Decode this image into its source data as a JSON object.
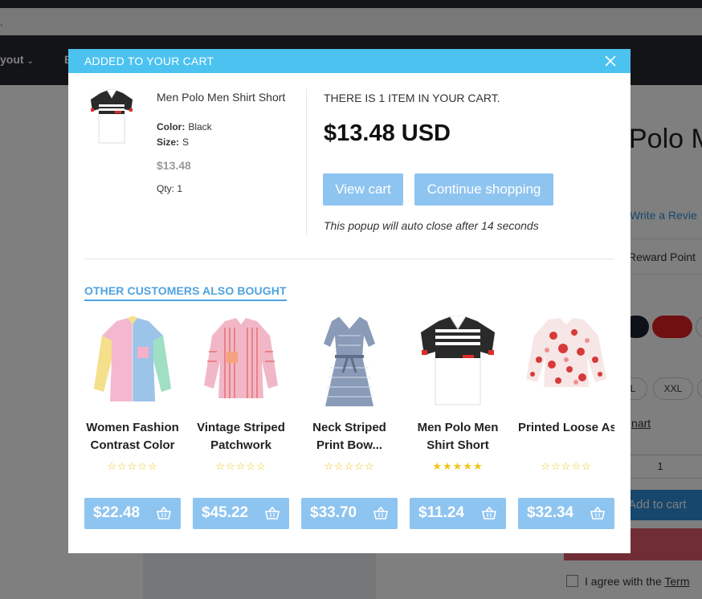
{
  "background": {
    "strip_text": ".",
    "nav_item_1": "yout",
    "nav_item_2": "E",
    "product_title": "Polo M",
    "review_link": "Write a Revie",
    "reward_points": "Reward Point",
    "size_l": "L",
    "size_xxl": "XXL",
    "compare_link": "nart",
    "qty_value": "1",
    "add_to_cart": "Add to cart",
    "agree_text": "I agree with the ",
    "terms_link": "Term"
  },
  "modal": {
    "title": "ADDED TO YOUR CART",
    "item": {
      "name": "Men Polo Men Shirt Short",
      "color_label": "Color:",
      "color_value": "Black",
      "size_label": "Size:",
      "size_value": "S",
      "price": "$13.48",
      "qty": "Qty: 1"
    },
    "cart_count": "THERE IS 1 ITEM IN YOUR CART.",
    "cart_total": "$13.48 USD",
    "view_cart_label": "View cart",
    "continue_label": "Continue shopping",
    "auto_close_text": "This popup will auto close after 14 seconds",
    "section_title": "OTHER CUSTOMERS ALSO BOUGHT",
    "products": [
      {
        "name": "Women Fashion Contrast Color",
        "price": "$22.48",
        "rating": 0,
        "icon": "colorblock-shirt-icon"
      },
      {
        "name": "Vintage Striped Patchwork",
        "price": "$45.22",
        "rating": 0,
        "icon": "striped-shirt-icon"
      },
      {
        "name": "Neck Striped Print Bow...",
        "price": "$33.70",
        "rating": 0,
        "icon": "dress-icon"
      },
      {
        "name": "Men Polo Men Shirt Short",
        "price": "$11.24",
        "rating": 5,
        "icon": "polo-shirt-icon"
      },
      {
        "name": "Printed Loose As",
        "price": "$32.34",
        "rating": 0,
        "icon": "printed-blouse-icon"
      }
    ]
  },
  "colors": {
    "header": "#4bc2f0",
    "button": "#8ec4f0",
    "link": "#4fa3e0",
    "star": "#f0c419"
  }
}
